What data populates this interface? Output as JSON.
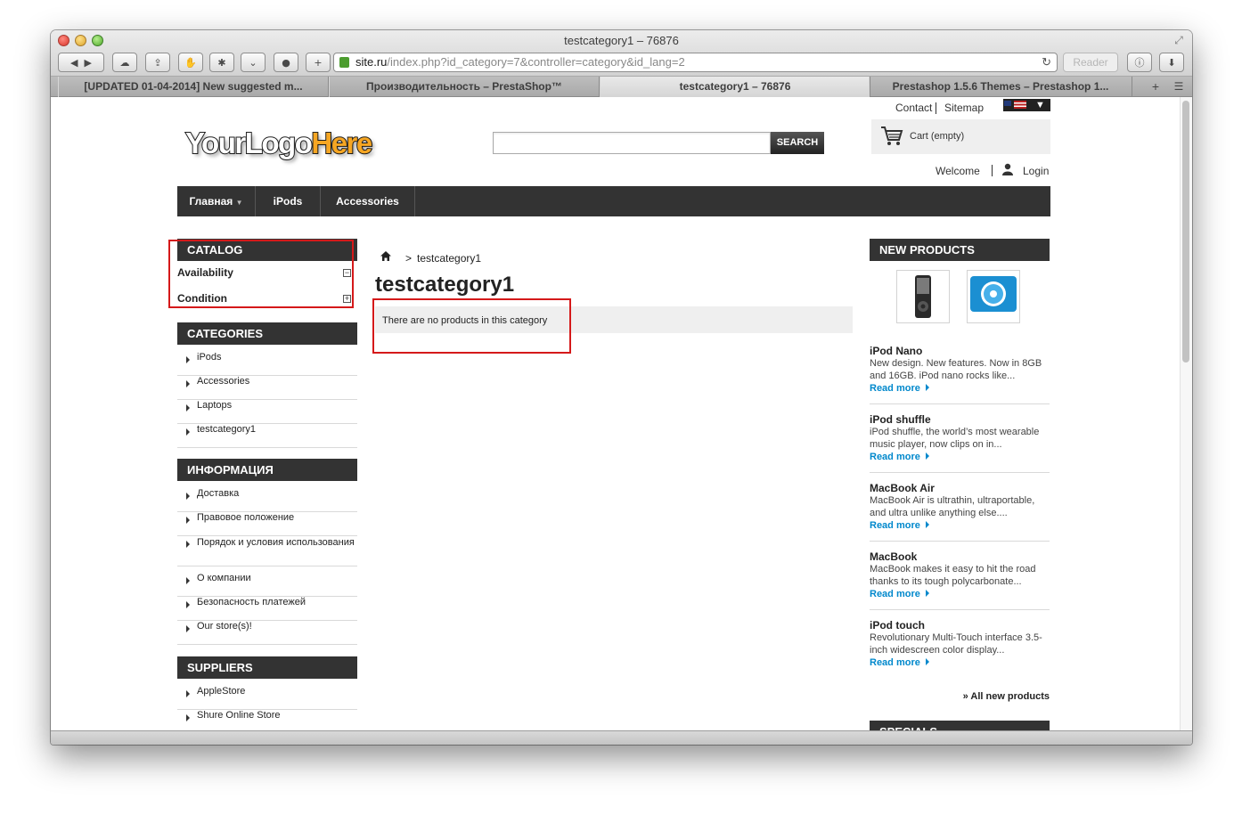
{
  "browser": {
    "window_title": "testcategory1 – 76876",
    "url_host": "site.ru",
    "url_path": "/index.php?id_category=7&controller=category&id_lang=2",
    "reader_label": "Reader",
    "tabs": [
      {
        "label": "[UPDATED 01-04-2014] New suggested m..."
      },
      {
        "label": "Производительность – PrestaShop™"
      },
      {
        "label": "testcategory1 – 76876"
      },
      {
        "label": "Prestashop 1.5.6 Themes – Prestashop 1..."
      }
    ],
    "toolbar_icons": [
      "back-icon",
      "forward-icon",
      "icloud-icon",
      "share-icon",
      "privacy-icon",
      "extension-icon",
      "pocket-icon",
      "record-icon",
      "add-tab-icon"
    ]
  },
  "header": {
    "logo_main": "YourLogo",
    "logo_accent": "Here",
    "links": [
      "Contact",
      "Sitemap"
    ],
    "search_button": "SEARCH",
    "search_value": "",
    "cart_label": "Cart (empty)",
    "welcome": "Welcome",
    "login": "Login"
  },
  "nav": {
    "items": [
      "Главная",
      "iPods",
      "Accessories"
    ]
  },
  "sidebar": {
    "catalog_title": "CATALOG",
    "facets": [
      {
        "label": "Availability",
        "toggle": "−"
      },
      {
        "label": "Condition",
        "toggle": "+"
      }
    ],
    "categories_title": "CATEGORIES",
    "categories": [
      "iPods",
      "Accessories",
      "Laptops",
      "testcategory1"
    ],
    "info_title": "ИНФОРМАЦИЯ",
    "info": [
      "Доставка",
      "Правовое положение",
      "Порядок и условия использования",
      "О компании",
      "Безопасность платежей",
      "Our store(s)!"
    ],
    "suppliers_title": "SUPPLIERS",
    "suppliers": [
      "AppleStore",
      "Shure Online Store"
    ]
  },
  "main": {
    "breadcrumb_sep": ">",
    "breadcrumb_current": "testcategory1",
    "title": "testcategory1",
    "empty_notice": "There are no products in this category"
  },
  "right": {
    "new_products_title": "NEW PRODUCTS",
    "products": [
      {
        "name": "iPod Nano",
        "desc": "New design. New features. Now in 8GB and 16GB. iPod nano rocks like...",
        "more": "Read more"
      },
      {
        "name": "iPod shuffle",
        "desc": "iPod shuffle, the world’s most wearable music player, now clips on in...",
        "more": "Read more"
      },
      {
        "name": "MacBook Air",
        "desc": "MacBook Air is ultrathin, ultraportable, and ultra unlike anything else....",
        "more": "Read more"
      },
      {
        "name": "MacBook",
        "desc": "MacBook makes it easy to hit the road thanks to its tough polycarbonate...",
        "more": "Read more"
      },
      {
        "name": "iPod touch",
        "desc": "Revolutionary Multi-Touch interface 3.5-inch widescreen color display...",
        "more": "Read more"
      }
    ],
    "all_new_products": "» All new products",
    "specials_title": "SPECIALS"
  }
}
